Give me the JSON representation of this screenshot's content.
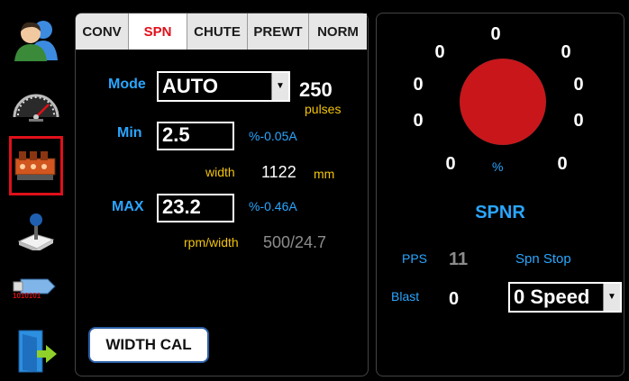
{
  "sidebar": {
    "items": [
      {
        "name": "users",
        "icon": "users-icon"
      },
      {
        "name": "speedometer",
        "icon": "speedometer-icon"
      },
      {
        "name": "valves",
        "icon": "hydraulic-valve-icon",
        "selected": true
      },
      {
        "name": "joystick",
        "icon": "joystick-icon"
      },
      {
        "name": "usb",
        "icon": "usb-drive-icon",
        "label": "1010101"
      },
      {
        "name": "exit",
        "icon": "exit-door-icon"
      }
    ],
    "selected_color": "#e0101a"
  },
  "tabs": [
    {
      "label": "CONV"
    },
    {
      "label": "SPN",
      "active": true
    },
    {
      "label": "CHUTE"
    },
    {
      "label": "PREWT"
    },
    {
      "label": "NORM"
    }
  ],
  "left": {
    "mode_label": "Mode",
    "mode_value": "AUTO",
    "pulses_value": "250",
    "pulses_label": "pulses",
    "min_label": "Min",
    "min_value": "2.5",
    "min_note": "%-0.05A",
    "width_label": "width",
    "width_value": "1122",
    "width_unit": "mm",
    "max_label": "MAX",
    "max_value": "23.2",
    "max_note": "%-0.46A",
    "rpm_label": "rpm/width",
    "rpm_value": "500/24.7",
    "width_cal_label": "WIDTH CAL"
  },
  "right": {
    "dial": {
      "values": [
        "0",
        "0",
        "0",
        "0",
        "0",
        "0",
        "0",
        "0",
        "0",
        "0"
      ],
      "center_label": "%",
      "knob_color": "#c8161b"
    },
    "title": "SPNR",
    "pps_label": "PPS",
    "pps_value": "11",
    "spn_stop_label": "Spn Stop",
    "blast_label": "Blast",
    "blast_value": "0",
    "speed_value": "0 Speed"
  },
  "colors": {
    "accent_blue": "#2aa6ff",
    "label_yellow": "#f3c40a",
    "tab_active_text": "#e0101a"
  }
}
